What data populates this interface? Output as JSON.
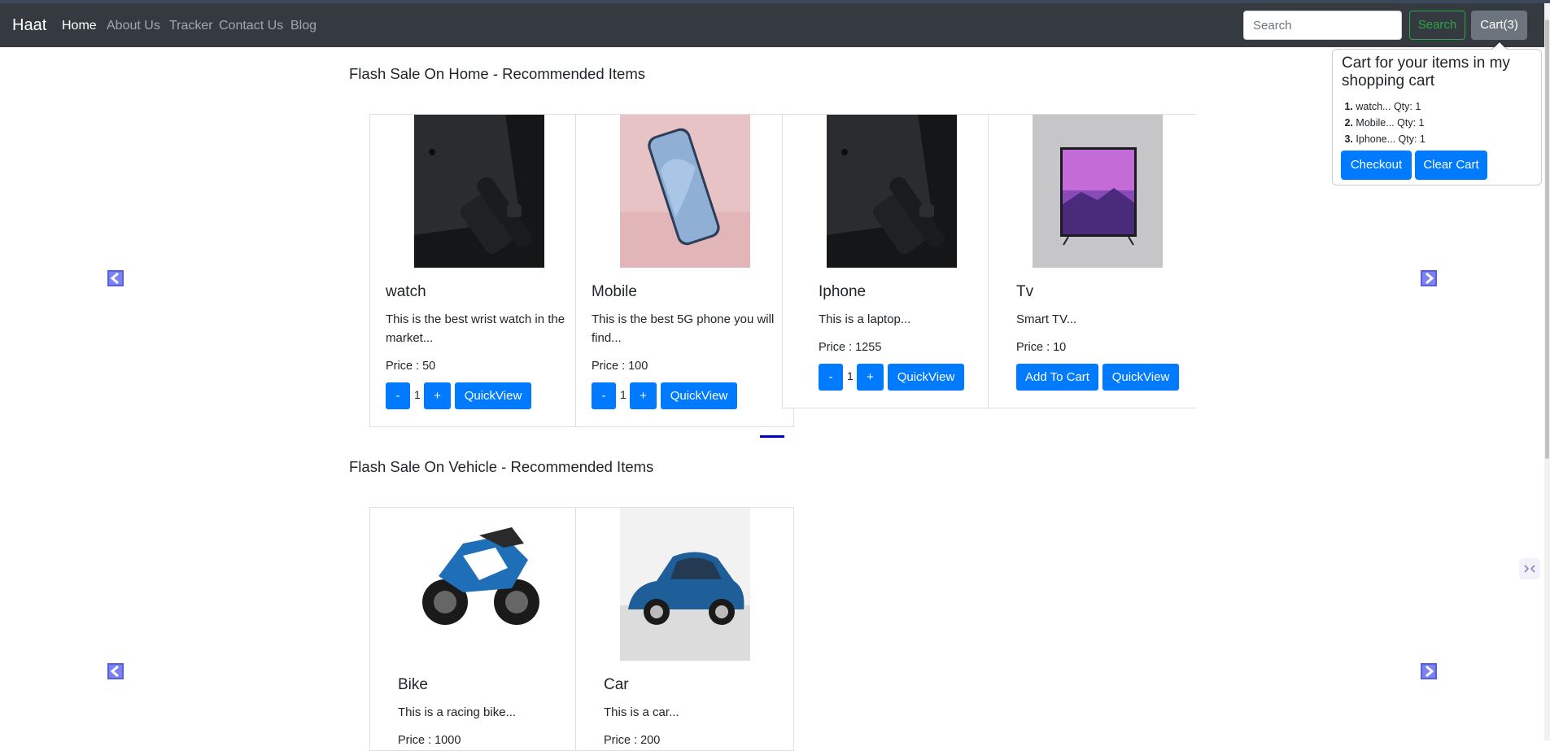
{
  "navbar": {
    "brand": "Haat",
    "links": [
      "Home",
      "About Us",
      "Tracker",
      "Contact Us",
      "Blog"
    ],
    "search_placeholder": "Search",
    "search_button": "Search",
    "cart_button": "Cart(3)"
  },
  "cart_popover": {
    "title": "Cart for your items in my shopping cart",
    "items": [
      {
        "num": "1.",
        "text": "watch... Qty: 1"
      },
      {
        "num": "2.",
        "text": "Mobile... Qty: 1"
      },
      {
        "num": "3.",
        "text": "Iphone... Qty: 1"
      }
    ],
    "checkout": "Checkout",
    "clear": "Clear Cart"
  },
  "sections": [
    {
      "title": "Flash Sale On Home - Recommended Items",
      "products": [
        {
          "name": "watch",
          "desc": "This is the best wrist watch in the market...",
          "price": "Price : 50",
          "qty": "1",
          "minus": "-",
          "plus": "+",
          "quickview": "QuickView"
        },
        {
          "name": "Mobile",
          "desc": "This is the best 5G phone you will find...",
          "price": "Price : 100",
          "qty": "1",
          "minus": "-",
          "plus": "+",
          "quickview": "QuickView"
        },
        {
          "name": "Iphone",
          "desc": "This is a laptop...",
          "price": "Price : 1255",
          "qty": "1",
          "minus": "-",
          "plus": "+",
          "quickview": "QuickView"
        },
        {
          "name": "Tv",
          "desc": "Smart TV...",
          "price": "Price : 10",
          "add_to_cart": "Add To Cart",
          "quickview": "QuickView"
        }
      ]
    },
    {
      "title": "Flash Sale On Vehicle - Recommended Items",
      "products": [
        {
          "name": "Bike",
          "desc": "This is a racing bike...",
          "price": "Price : 1000"
        },
        {
          "name": "Car",
          "desc": "This is a car...",
          "price": "Price : 200"
        }
      ]
    }
  ],
  "colors": {
    "navbar": "#343a40",
    "primary": "#007bff",
    "success": "#28a745",
    "secondary": "#6c757d",
    "carousel_control": "#7b82f2"
  },
  "icons": {
    "prev": "chevron-left-icon",
    "next": "chevron-right-icon"
  }
}
